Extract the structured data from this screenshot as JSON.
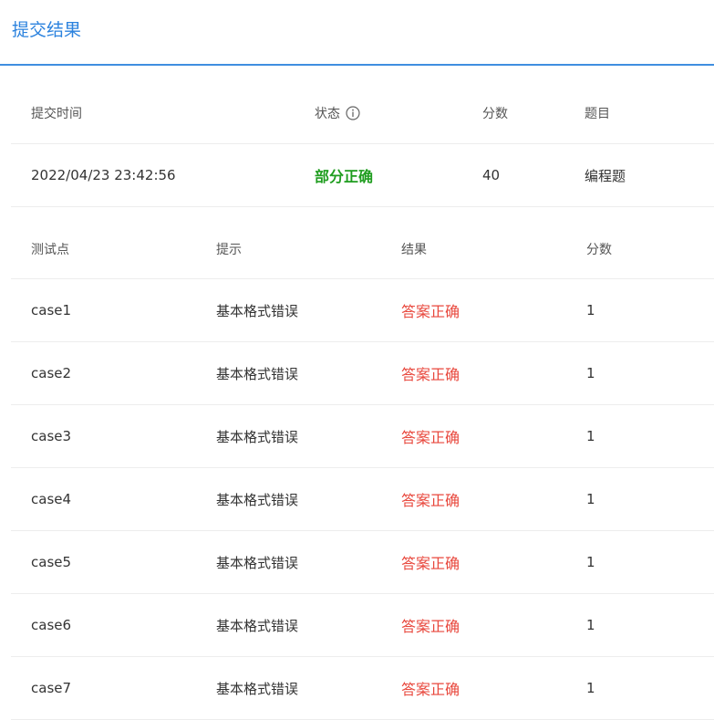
{
  "header": {
    "title": "提交结果"
  },
  "summary": {
    "columns": {
      "time": "提交时间",
      "status": "状态",
      "score": "分数",
      "problem": "题目"
    },
    "row": {
      "time": "2022/04/23 23:42:56",
      "status": "部分正确",
      "score": "40",
      "problem": "编程题"
    },
    "status_color": "#1f9d1f"
  },
  "cases": {
    "columns": {
      "point": "测试点",
      "hint": "提示",
      "result": "结果",
      "score": "分数"
    },
    "result_color": "#e8473c",
    "rows": [
      {
        "point": "case1",
        "hint": "基本格式错误",
        "result": "答案正确",
        "score": "1"
      },
      {
        "point": "case2",
        "hint": "基本格式错误",
        "result": "答案正确",
        "score": "1"
      },
      {
        "point": "case3",
        "hint": "基本格式错误",
        "result": "答案正确",
        "score": "1"
      },
      {
        "point": "case4",
        "hint": "基本格式错误",
        "result": "答案正确",
        "score": "1"
      },
      {
        "point": "case5",
        "hint": "基本格式错误",
        "result": "答案正确",
        "score": "1"
      },
      {
        "point": "case6",
        "hint": "基本格式错误",
        "result": "答案正确",
        "score": "1"
      },
      {
        "point": "case7",
        "hint": "基本格式错误",
        "result": "答案正确",
        "score": "1"
      }
    ]
  },
  "icons": {
    "status_info": "info-circle-icon"
  },
  "accent_color": "#2b82de"
}
